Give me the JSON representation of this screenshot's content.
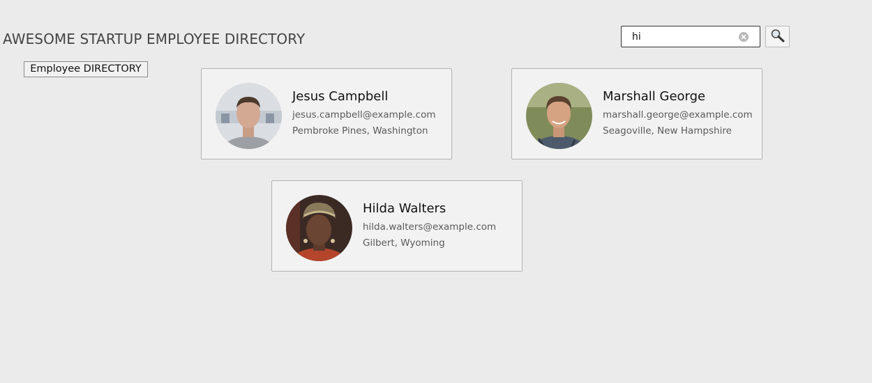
{
  "header": {
    "title": "AWESOME STARTUP EMPLOYEE DIRECTORY",
    "directory_button": "Employee DIRECTORY"
  },
  "search": {
    "value": "hi",
    "clear_icon": "clear-circle-x-icon",
    "button_icon": "magnifier-search-icon"
  },
  "employees": [
    {
      "name": "Jesus Campbell",
      "email": "jesus.campbell@example.com",
      "location": "Pembroke Pines, Washington"
    },
    {
      "name": "Marshall George",
      "email": "marshall.george@example.com",
      "location": "Seagoville, New Hampshire"
    },
    {
      "name": "Hilda Walters",
      "email": "hilda.walters@example.com",
      "location": "Gilbert, Wyoming"
    }
  ],
  "colors": {
    "background": "#ebebeb",
    "card_background": "#f2f2f2",
    "card_border": "#b3b3b3",
    "secondary_text": "#5a5a5a"
  }
}
